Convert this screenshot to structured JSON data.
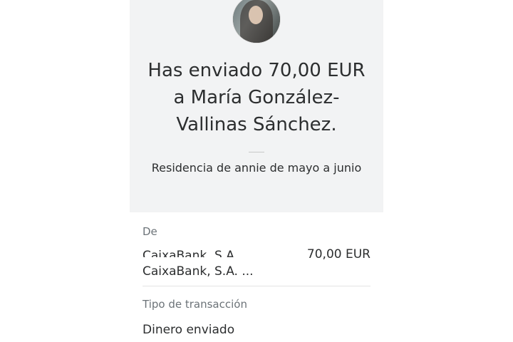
{
  "header": {
    "avatar_icon": "recipient-avatar",
    "title": "Has enviado 70,00 EUR a María González-Vallinas Sánchez.",
    "title_lines": [
      "Has enviado 70,00 EUR",
      "a María González-",
      "Vallinas Sánchez."
    ],
    "note": "Residencia de annie de mayo a junio"
  },
  "details": {
    "from_label": "De",
    "from_name": "CaixaBank, S.A.",
    "from_name_full": "CaixaBank, S.A. ...",
    "from_amount": "70,00 EUR",
    "type_label": "Tipo de transacción",
    "type_value": "Dinero enviado"
  },
  "colors": {
    "header_background": "#f2f3f4",
    "text_primary": "#2c2e2f",
    "text_secondary": "#6c7378"
  }
}
